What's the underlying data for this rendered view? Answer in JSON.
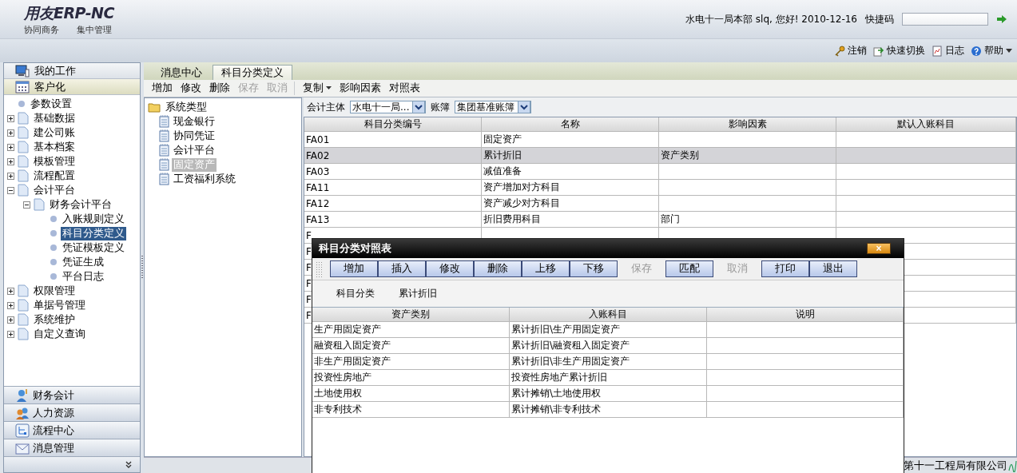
{
  "header": {
    "logo": "用友ERP-NC",
    "slogan": [
      "协同商务",
      "集中管理"
    ],
    "greeting": "水电十一局本部 slq, 您好! 2010-12-16",
    "quick_code": {
      "label": "快捷码"
    }
  },
  "top_links": [
    {
      "label": "注销",
      "kind": "key"
    },
    {
      "label": "快速切换",
      "kind": "switch"
    },
    {
      "label": "日志",
      "kind": "log"
    },
    {
      "label": "帮助",
      "kind": "help"
    }
  ],
  "sidebar": {
    "sections": [
      {
        "label": "我的工作",
        "kind": "work",
        "selected": false
      },
      {
        "label": "客户化",
        "kind": "custom",
        "selected": true
      }
    ],
    "tree": [
      {
        "label": "参数设置",
        "kind": "leaf",
        "selected": false
      },
      {
        "label": "基础数据",
        "kind": "page",
        "expanded": false,
        "selected": false
      },
      {
        "label": "建公司账",
        "kind": "page",
        "expanded": false,
        "selected": false
      },
      {
        "label": "基本档案",
        "kind": "page",
        "expanded": false,
        "selected": false
      },
      {
        "label": "模板管理",
        "kind": "page",
        "expanded": false,
        "selected": false
      },
      {
        "label": "流程配置",
        "kind": "page",
        "expanded": false,
        "selected": false
      },
      {
        "label": "会计平台",
        "kind": "page",
        "expanded": true,
        "selected": false,
        "children": [
          {
            "label": "财务会计平台",
            "kind": "page",
            "expanded": true,
            "selected": false,
            "children": [
              {
                "label": "入账规则定义",
                "kind": "leaf",
                "selected": false
              },
              {
                "label": "科目分类定义",
                "kind": "leaf",
                "selected": true
              },
              {
                "label": "凭证模板定义",
                "kind": "leaf",
                "selected": false
              },
              {
                "label": "凭证生成",
                "kind": "leaf",
                "selected": false
              },
              {
                "label": "平台日志",
                "kind": "leaf",
                "selected": false
              }
            ]
          }
        ]
      },
      {
        "label": "权限管理",
        "kind": "page",
        "expanded": false,
        "selected": false
      },
      {
        "label": "单据号管理",
        "kind": "page",
        "expanded": false,
        "selected": false
      },
      {
        "label": "系统维护",
        "kind": "page",
        "expanded": false,
        "selected": false
      },
      {
        "label": "自定义查询",
        "kind": "page",
        "expanded": false,
        "selected": false
      }
    ],
    "modules": [
      {
        "label": "财务会计",
        "kind": "finance"
      },
      {
        "label": "人力资源",
        "kind": "people"
      },
      {
        "label": "流程中心",
        "kind": "flow"
      },
      {
        "label": "消息管理",
        "kind": "mail"
      }
    ]
  },
  "tabs": [
    {
      "label": "消息中心",
      "selected": false
    },
    {
      "label": "科目分类定义",
      "selected": true
    }
  ],
  "toolbar": {
    "left": [
      {
        "label": "增加",
        "disabled": false
      },
      {
        "label": "修改",
        "disabled": false
      },
      {
        "label": "删除",
        "disabled": false
      },
      {
        "label": "保存",
        "disabled": true
      },
      {
        "label": "取消",
        "disabled": true
      }
    ],
    "right": [
      {
        "label": "复制",
        "kind": "menu",
        "disabled": false
      },
      {
        "label": "影响因素",
        "kind": "plain",
        "disabled": false
      },
      {
        "label": "对照表",
        "kind": "plain",
        "disabled": false
      }
    ]
  },
  "type_tree": {
    "root": "系统类型",
    "children": [
      {
        "label": "现金银行",
        "selected": false
      },
      {
        "label": "协同凭证",
        "selected": false
      },
      {
        "label": "会计平台",
        "selected": false
      },
      {
        "label": "固定资产",
        "selected": true
      },
      {
        "label": "工资福利系统",
        "selected": false
      }
    ]
  },
  "filters": [
    {
      "label": "会计主体",
      "value": "水电十一局..."
    },
    {
      "label": "账簿",
      "value": "集团基准账簿"
    }
  ],
  "grid": {
    "columns": [
      "科目分类编号",
      "名称",
      "影响因素",
      "默认入账科目"
    ],
    "rows": [
      {
        "code": "FA01",
        "name": "固定资产",
        "selected": false
      },
      {
        "code": "FA02",
        "name": "累计折旧",
        "factor": "资产类别",
        "selected": true
      },
      {
        "code": "FA03",
        "name": "减值准备",
        "selected": false
      },
      {
        "code": "FA11",
        "name": "资产增加对方科目",
        "selected": false
      },
      {
        "code": "FA12",
        "name": "资产减少对方科目",
        "selected": false
      },
      {
        "code": "FA13",
        "name": "折旧费用科目",
        "factor": "部门",
        "selected": false
      },
      {
        "code": "F",
        "selected": false
      },
      {
        "code": "F",
        "selected": false
      },
      {
        "code": "F",
        "selected": false
      },
      {
        "code": "F",
        "selected": false
      },
      {
        "code": "F",
        "selected": false
      },
      {
        "code": "F",
        "selected": false
      }
    ]
  },
  "dialog": {
    "title": "科目分类对照表",
    "close": "×",
    "buttons": [
      {
        "label": "增加",
        "disabled": false
      },
      {
        "label": "插入",
        "disabled": false
      },
      {
        "label": "修改",
        "disabled": false
      },
      {
        "label": "删除",
        "disabled": false
      },
      {
        "label": "上移",
        "disabled": false
      },
      {
        "label": "下移",
        "disabled": false
      },
      {
        "label": "保存",
        "disabled": true
      },
      {
        "label": "匹配",
        "disabled": false
      },
      {
        "label": "取消",
        "disabled": true
      },
      {
        "label": "打印",
        "disabled": false
      },
      {
        "label": "退出",
        "disabled": false
      }
    ],
    "info": [
      "科目分类",
      "累计折旧"
    ],
    "columns": [
      "资产类别",
      "入账科目",
      "说明"
    ],
    "rows": [
      {
        "category": "生产用固定资产",
        "account": "累计折旧\\生产用固定资产"
      },
      {
        "category": "融资租入固定资产",
        "account": "累计折旧\\融资租入固定资产"
      },
      {
        "category": "非生产用固定资产",
        "account": "累计折旧\\非生产用固定资产"
      },
      {
        "category": "投资性房地产",
        "account": "投资性房地产累计折旧"
      },
      {
        "category": "土地使用权",
        "account": "累计摊销\\土地使用权"
      },
      {
        "category": "非专利技术",
        "account": "累计摊销\\非专利技术"
      }
    ]
  },
  "status_bar": {
    "company": "第十一工程局有限公司"
  }
}
